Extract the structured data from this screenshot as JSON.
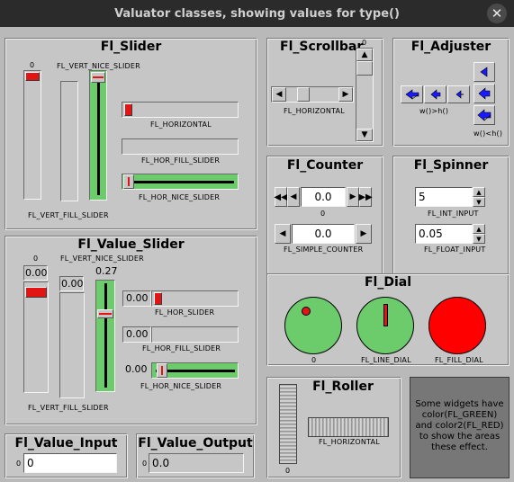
{
  "window": {
    "title": "Valuator classes, showing values for type()",
    "close_glyph": "✕"
  },
  "groups": {
    "slider": "Fl_Slider",
    "value_slider": "Fl_Value_Slider",
    "scrollbar": "Fl_Scrollbar",
    "adjuster": "Fl_Adjuster",
    "counter": "Fl_Counter",
    "spinner": "Fl_Spinner",
    "dial": "Fl_Dial",
    "roller": "Fl_Roller",
    "value_input": "Fl_Value_Input",
    "value_output": "Fl_Value_Output"
  },
  "slider": {
    "zero": "0",
    "vert_nice": "FL_VERT_NICE_SLIDER",
    "vert_fill": "FL_VERT_FILL_SLIDER",
    "horizontal": "FL_HORIZONTAL",
    "hor_fill": "FL_HOR_FILL_SLIDER",
    "hor_nice": "FL_HOR_NICE_SLIDER"
  },
  "value_slider": {
    "zero": "0",
    "vert_nice": "FL_VERT_NICE_SLIDER",
    "vert_fill": "FL_VERT_FILL_SLIDER",
    "hor": "FL_HOR_SLIDER",
    "hor_fill": "FL_HOR_FILL_SLIDER",
    "hor_nice": "FL_HOR_NICE_SLIDER",
    "v1": "0.00",
    "v2": "0.00",
    "v3": "0.27",
    "h1": "0.00",
    "h2": "0.00",
    "h3": "0.00"
  },
  "scrollbar": {
    "zero": "0",
    "horizontal": "FL_HORIZONTAL"
  },
  "adjuster": {
    "label1": "w()>h()",
    "label2": "w()<h()"
  },
  "counter": {
    "value1": "0.0",
    "label1": "0",
    "value2": "0.0",
    "label2": "FL_SIMPLE_COUNTER"
  },
  "spinner": {
    "value1": "5",
    "label1": "FL_INT_INPUT",
    "value2": "0.05",
    "label2": "FL_FLOAT_INPUT"
  },
  "dial": {
    "label1": "0",
    "label2": "FL_LINE_DIAL",
    "label3": "FL_FILL_DIAL"
  },
  "roller": {
    "zero": "0",
    "horizontal": "FL_HORIZONTAL"
  },
  "note": "Some widgets have color(FL_GREEN) and color2(FL_RED) to show the areas these effect.",
  "value_input": {
    "label": "0",
    "value": "0"
  },
  "value_output": {
    "label": "0",
    "value": "0.0"
  },
  "colors": {
    "green": "#6ccc6c",
    "red": "#e21414",
    "blue": "#1a1aff"
  }
}
